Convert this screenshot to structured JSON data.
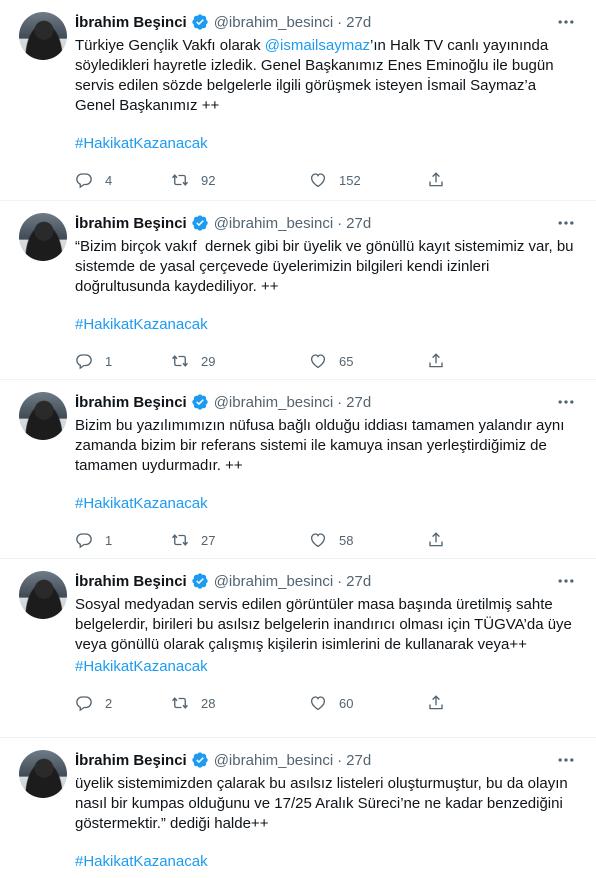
{
  "tweets": [
    {
      "name": "İbrahim Beşinci",
      "handle": "@ibrahim_besinci",
      "time": "27d",
      "text_before": "Türkiye Gençlik Vakfı olarak ",
      "mention": "@ismailsaymaz",
      "text_after": "’ın Halk TV canlı yayınında söyledikleri hayretle izledik. Genel Başkanımız Enes Eminoğlu ile bugün servis edilen sözde belgelerle ilgili görüşmek isteyen İsmail Saymaz’a Genel Başkanımız ++",
      "hashtag": "#HakikatKazanacak",
      "replies": "4",
      "retweets": "92",
      "likes": "152"
    },
    {
      "name": "İbrahim Beşinci",
      "handle": "@ibrahim_besinci",
      "time": "27d",
      "text": "“Bizim birçok vakıf  dernek gibi bir üyelik ve gönüllü kayıt sistemimiz var, bu sistemde de yasal çerçevede üyelerimizin bilgileri kendi izinleri doğrultusunda kaydediliyor. ++",
      "hashtag": "#HakikatKazanacak",
      "replies": "1",
      "retweets": "29",
      "likes": "65"
    },
    {
      "name": "İbrahim Beşinci",
      "handle": "@ibrahim_besinci",
      "time": "27d",
      "text": "Bizim bu yazılımımızın nüfusa bağlı olduğu iddiası tamamen yalandır aynı zamanda bizim bir referans sistemi ile kamuya insan yerleştirdiğimiz de tamamen uydurmadır. ++",
      "hashtag": "#HakikatKazanacak",
      "replies": "1",
      "retweets": "27",
      "likes": "58"
    },
    {
      "name": "İbrahim Beşinci",
      "handle": "@ibrahim_besinci",
      "time": "27d",
      "text": "Sosyal medyadan servis edilen görüntüler masa başında üretilmiş sahte belgelerdir, birileri bu asılsız belgelerin inandırıcı olması için TÜGVA’da üye veya gönüllü olarak çalışmış kişilerin isimlerini de kullanarak veya++",
      "hashtag": "#HakikatKazanacak",
      "replies": "2",
      "retweets": "28",
      "likes": "60"
    },
    {
      "name": "İbrahim Beşinci",
      "handle": "@ibrahim_besinci",
      "time": "27d",
      "text": "üyelik sistemimizden çalarak bu asılsız listeleri oluşturmuştur, bu da olayın nasıl bir kumpas olduğunu ve 17/25 Aralık Süreci’ne ne kadar benzediğini göstermektir.” dediği halde++",
      "hashtag": "#HakikatKazanacak"
    }
  ],
  "colors": {
    "accent": "#1d9bf0",
    "muted": "#536471",
    "text": "#0f1419"
  },
  "icons": [
    "verified-badge-icon",
    "more-icon",
    "reply-icon",
    "retweet-icon",
    "like-icon",
    "share-icon"
  ]
}
